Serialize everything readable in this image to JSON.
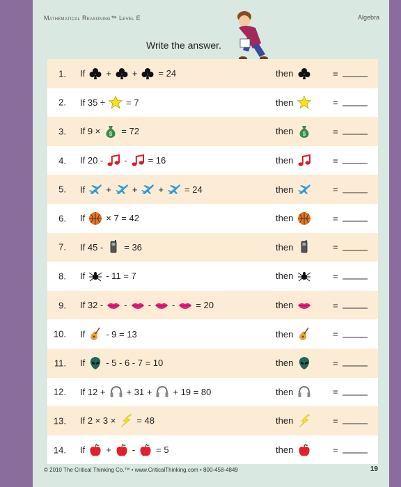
{
  "header": {
    "left": "Mathematical Reasoning™ Level E",
    "right": "Algebra"
  },
  "instruction": "Write the answer.",
  "then_label": "then",
  "equals": "=",
  "problems": [
    {
      "num": "1.",
      "parts": [
        {
          "t": "text",
          "v": "If"
        },
        {
          "t": "icon",
          "v": "club"
        },
        {
          "t": "text",
          "v": "+"
        },
        {
          "t": "icon",
          "v": "club"
        },
        {
          "t": "text",
          "v": "+"
        },
        {
          "t": "icon",
          "v": "club"
        },
        {
          "t": "text",
          "v": "= 24"
        }
      ],
      "then_icon": "club"
    },
    {
      "num": "2.",
      "parts": [
        {
          "t": "text",
          "v": "If 35 ÷"
        },
        {
          "t": "icon",
          "v": "star"
        },
        {
          "t": "text",
          "v": "= 7"
        }
      ],
      "then_icon": "star"
    },
    {
      "num": "3.",
      "parts": [
        {
          "t": "text",
          "v": "If 9 ×"
        },
        {
          "t": "icon",
          "v": "moneybag"
        },
        {
          "t": "text",
          "v": "= 72"
        }
      ],
      "then_icon": "moneybag"
    },
    {
      "num": "4.",
      "parts": [
        {
          "t": "text",
          "v": "If 20 -"
        },
        {
          "t": "icon",
          "v": "note"
        },
        {
          "t": "text",
          "v": "-"
        },
        {
          "t": "icon",
          "v": "note"
        },
        {
          "t": "text",
          "v": "= 16"
        }
      ],
      "then_icon": "note"
    },
    {
      "num": "5.",
      "parts": [
        {
          "t": "text",
          "v": "If"
        },
        {
          "t": "icon",
          "v": "plane"
        },
        {
          "t": "text",
          "v": "+"
        },
        {
          "t": "icon",
          "v": "plane"
        },
        {
          "t": "text",
          "v": "+"
        },
        {
          "t": "icon",
          "v": "plane"
        },
        {
          "t": "text",
          "v": "+"
        },
        {
          "t": "icon",
          "v": "plane"
        },
        {
          "t": "text",
          "v": "= 24"
        }
      ],
      "then_icon": "plane"
    },
    {
      "num": "6.",
      "parts": [
        {
          "t": "text",
          "v": "If"
        },
        {
          "t": "icon",
          "v": "ball"
        },
        {
          "t": "text",
          "v": "× 7 = 42"
        }
      ],
      "then_icon": "ball"
    },
    {
      "num": "7.",
      "parts": [
        {
          "t": "text",
          "v": "If 45 -"
        },
        {
          "t": "icon",
          "v": "phone"
        },
        {
          "t": "text",
          "v": "= 36"
        }
      ],
      "then_icon": "phone"
    },
    {
      "num": "8.",
      "parts": [
        {
          "t": "text",
          "v": "If"
        },
        {
          "t": "icon",
          "v": "spider"
        },
        {
          "t": "text",
          "v": "- 11 = 7"
        }
      ],
      "then_icon": "spider"
    },
    {
      "num": "9.",
      "parts": [
        {
          "t": "text",
          "v": "If 32 -"
        },
        {
          "t": "icon",
          "v": "lips"
        },
        {
          "t": "text",
          "v": "-"
        },
        {
          "t": "icon",
          "v": "lips"
        },
        {
          "t": "text",
          "v": "-"
        },
        {
          "t": "icon",
          "v": "lips"
        },
        {
          "t": "text",
          "v": "-"
        },
        {
          "t": "icon",
          "v": "lips"
        },
        {
          "t": "text",
          "v": "= 20"
        }
      ],
      "then_icon": "lips"
    },
    {
      "num": "10.",
      "parts": [
        {
          "t": "text",
          "v": "If"
        },
        {
          "t": "icon",
          "v": "guitar"
        },
        {
          "t": "text",
          "v": "- 9 = 13"
        }
      ],
      "then_icon": "guitar"
    },
    {
      "num": "11.",
      "parts": [
        {
          "t": "text",
          "v": "If"
        },
        {
          "t": "icon",
          "v": "alien"
        },
        {
          "t": "text",
          "v": "- 5 - 6 - 7 = 10"
        }
      ],
      "then_icon": "alien"
    },
    {
      "num": "12.",
      "parts": [
        {
          "t": "text",
          "v": "If 12 +"
        },
        {
          "t": "icon",
          "v": "headphones"
        },
        {
          "t": "text",
          "v": "+ 31 +"
        },
        {
          "t": "icon",
          "v": "headphones"
        },
        {
          "t": "text",
          "v": "+ 19 = 80"
        }
      ],
      "then_icon": "headphones"
    },
    {
      "num": "13.",
      "parts": [
        {
          "t": "text",
          "v": "If 2 × 3 ×"
        },
        {
          "t": "icon",
          "v": "bolt"
        },
        {
          "t": "text",
          "v": "= 48"
        }
      ],
      "then_icon": "bolt"
    },
    {
      "num": "14.",
      "parts": [
        {
          "t": "text",
          "v": "If"
        },
        {
          "t": "icon",
          "v": "apple"
        },
        {
          "t": "text",
          "v": "+"
        },
        {
          "t": "icon",
          "v": "apple"
        },
        {
          "t": "text",
          "v": "-"
        },
        {
          "t": "icon",
          "v": "apple"
        },
        {
          "t": "text",
          "v": "= 5"
        }
      ],
      "then_icon": "apple"
    }
  ],
  "footer": {
    "left": "© 2010 The Critical Thinking Co.™ • www.CriticalThinking.com • 800-458-4849",
    "page": "19"
  }
}
